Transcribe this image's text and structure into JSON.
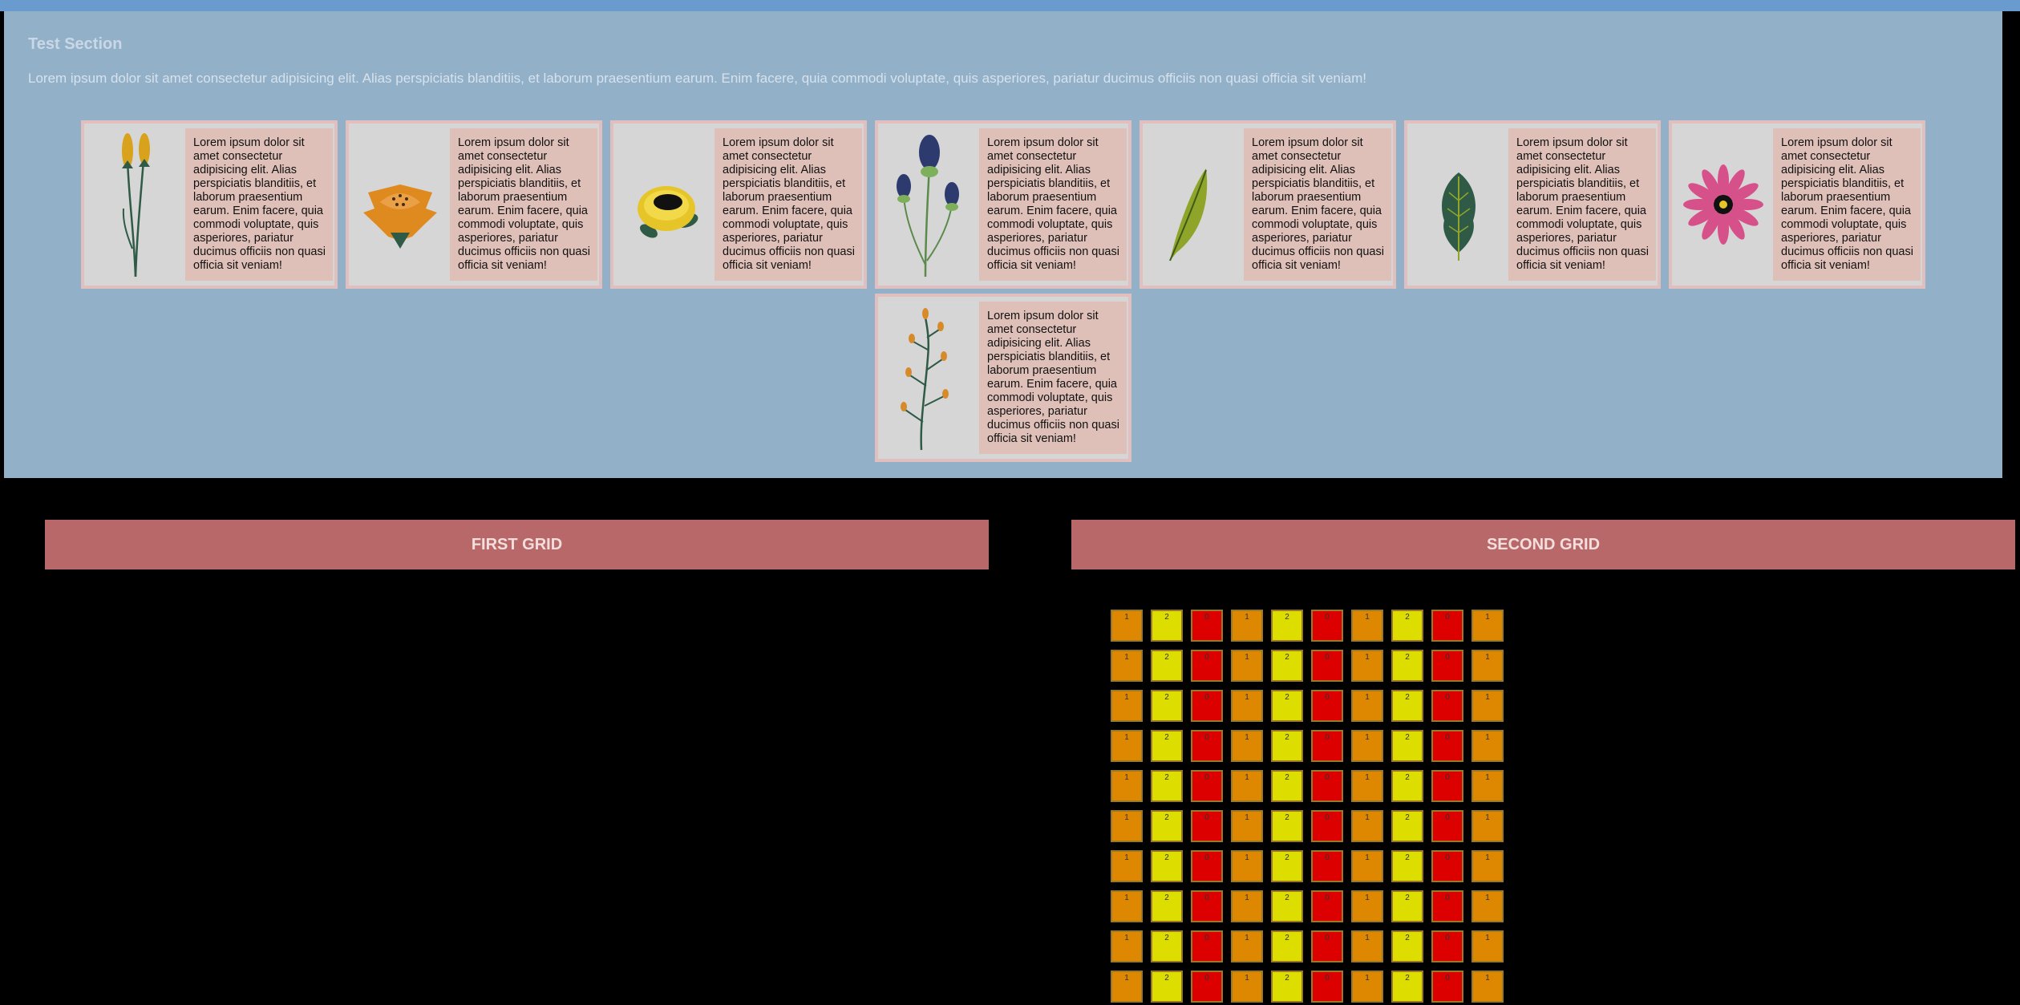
{
  "section": {
    "title": "Test Section",
    "description": "Lorem ipsum dolor sit amet consectetur adipisicing elit. Alias perspiciatis blanditiis, et laborum praesentium earum. Enim facere, quia commodi voluptate, quis asperiores, pariatur ducimus officiis non quasi officia sit veniam!"
  },
  "cards": [
    {
      "icon": "cattail-plant-icon",
      "text": "Lorem ipsum dolor sit amet consectetur adipisicing elit. Alias perspiciatis blanditiis, et laborum praesentium earum. Enim facere, quia commodi voluptate, quis asperiores, pariatur ducimus officiis non quasi officia sit veniam!"
    },
    {
      "icon": "orange-flower-icon",
      "text": "Lorem ipsum dolor sit amet consectetur adipisicing elit. Alias perspiciatis blanditiis, et laborum praesentium earum. Enim facere, quia commodi voluptate, quis asperiores, pariatur ducimus officiis non quasi officia sit veniam!"
    },
    {
      "icon": "yellow-flower-icon",
      "text": "Lorem ipsum dolor sit amet consectetur adipisicing elit. Alias perspiciatis blanditiis, et laborum praesentium earum. Enim facere, quia commodi voluptate, quis asperiores, pariatur ducimus officiis non quasi officia sit veniam!"
    },
    {
      "icon": "thistle-plant-icon",
      "text": "Lorem ipsum dolor sit amet consectetur adipisicing elit. Alias perspiciatis blanditiis, et laborum praesentium earum. Enim facere, quia commodi voluptate, quis asperiores, pariatur ducimus officiis non quasi officia sit veniam!"
    },
    {
      "icon": "leaf-icon",
      "text": "Lorem ipsum dolor sit amet consectetur adipisicing elit. Alias perspiciatis blanditiis, et laborum praesentium earum. Enim facere, quia commodi voluptate, quis asperiores, pariatur ducimus officiis non quasi officia sit veniam!"
    },
    {
      "icon": "fern-leaf-icon",
      "text": "Lorem ipsum dolor sit amet consectetur adipisicing elit. Alias perspiciatis blanditiis, et laborum praesentium earum. Enim facere, quia commodi voluptate, quis asperiores, pariatur ducimus officiis non quasi officia sit veniam!"
    },
    {
      "icon": "pink-daisy-icon",
      "text": "Lorem ipsum dolor sit amet consectetur adipisicing elit. Alias perspiciatis blanditiis, et laborum praesentium earum. Enim facere, quia commodi voluptate, quis asperiores, pariatur ducimus officiis non quasi officia sit veniam!"
    },
    {
      "icon": "berry-branch-icon",
      "text": "Lorem ipsum dolor sit amet consectetur adipisicing elit. Alias perspiciatis blanditiis, et laborum praesentium earum. Enim facere, quia commodi voluptate, quis asperiores, pariatur ducimus officiis non quasi officia sit veniam!"
    }
  ],
  "grids": {
    "first_label": "FIRST GRID",
    "second_label": "SECOND GRID",
    "second_rows": [
      [
        "1",
        "2",
        "0",
        "1",
        "2",
        "0",
        "1",
        "2",
        "0",
        "1"
      ],
      [
        "1",
        "2",
        "0",
        "1",
        "2",
        "0",
        "1",
        "2",
        "0",
        "1"
      ],
      [
        "1",
        "2",
        "0",
        "1",
        "2",
        "0",
        "1",
        "2",
        "0",
        "1"
      ],
      [
        "1",
        "2",
        "0",
        "1",
        "2",
        "0",
        "1",
        "2",
        "0",
        "1"
      ],
      [
        "1",
        "2",
        "0",
        "1",
        "2",
        "0",
        "1",
        "2",
        "0",
        "1"
      ],
      [
        "1",
        "2",
        "0",
        "1",
        "2",
        "0",
        "1",
        "2",
        "0",
        "1"
      ],
      [
        "1",
        "2",
        "0",
        "1",
        "2",
        "0",
        "1",
        "2",
        "0",
        "1"
      ],
      [
        "1",
        "2",
        "0",
        "1",
        "2",
        "0",
        "1",
        "2",
        "0",
        "1"
      ],
      [
        "1",
        "2",
        "0",
        "1",
        "2",
        "0",
        "1",
        "2",
        "0",
        "1"
      ],
      [
        "1",
        "2",
        "0",
        "1",
        "2",
        "0",
        "1",
        "2",
        "0",
        "1"
      ]
    ],
    "value_colors": {
      "0": "#dd0000",
      "1": "#dd8800",
      "2": "#dddd00"
    }
  }
}
